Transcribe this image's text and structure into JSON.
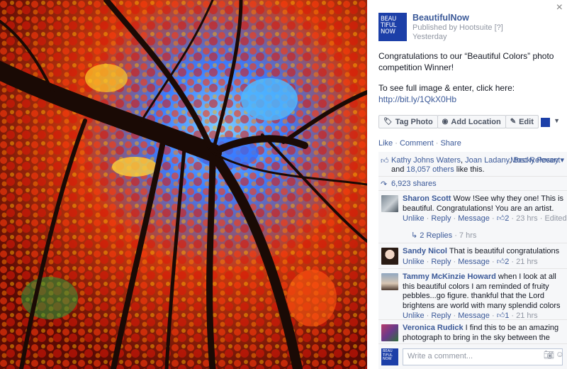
{
  "page": {
    "name": "BeautifulNow",
    "logo_lines": [
      "BEAU",
      "TIFUL",
      "NOW"
    ],
    "published_by": "Published by Hootsuite",
    "help_mark": "[?]",
    "time": "Yesterday",
    "close_glyph": "×",
    "brand_color": "#1c3fa8",
    "link_color": "#3b5998"
  },
  "post": {
    "line1": "Congratulations to our “Beautiful Colors” photo competition Winner!",
    "line2": "To see full image & enter, click here:",
    "link": "http://bit.ly/1QkX0Hb"
  },
  "actions": {
    "tag_photo": "Tag Photo",
    "add_location": "Add Location",
    "edit": "Edit",
    "tag_icon": "tag-icon",
    "location_icon": "location-pin-icon",
    "edit_icon": "pencil-icon"
  },
  "ufi_links": {
    "like": "Like",
    "comment": "Comment",
    "share": "Share",
    "dot": "·"
  },
  "likes": {
    "person1": "Kathy Johns Waters",
    "person2": "Joan Ladany",
    "person3": "Becky Posey",
    "and": "and",
    "others": "18,057 others",
    "suffix": "like this.",
    "sort": "Most Relevant",
    "sort_caret": "▾"
  },
  "shares": {
    "count": "6,923 shares"
  },
  "comments": [
    {
      "name": "Sharon Scott",
      "text": "Wow !See why they one! This is beautiful. Congratulations! You are an artist.",
      "unlike": "Unlike",
      "reply": "Reply",
      "message": "Message",
      "likes": "2",
      "time": "23 hrs",
      "edited": "Edited",
      "replies": "2 Replies",
      "replies_time": "7 hrs"
    },
    {
      "name": "Sandy Nicol",
      "text": "That is beautiful congratulations",
      "unlike": "Unlike",
      "reply": "Reply",
      "message": "Message",
      "likes": "2",
      "time": "21 hrs"
    },
    {
      "name": "Tammy McKinzie Howard",
      "text": "when I look at all this beautiful colors I am reminded of fruity pebbles...go figure. thankful that the Lord brightens are world with many splendid colors",
      "unlike": "Unlike",
      "reply": "Reply",
      "message": "Message",
      "likes": "1",
      "time": "21 hrs"
    },
    {
      "name": "Veronica Rudick",
      "text": "I find this to be an amazing photograph to bring in the sky between the leaves. Makes me want to lay down on the grass"
    }
  ],
  "write_comment": {
    "placeholder": "Write a comment..."
  }
}
